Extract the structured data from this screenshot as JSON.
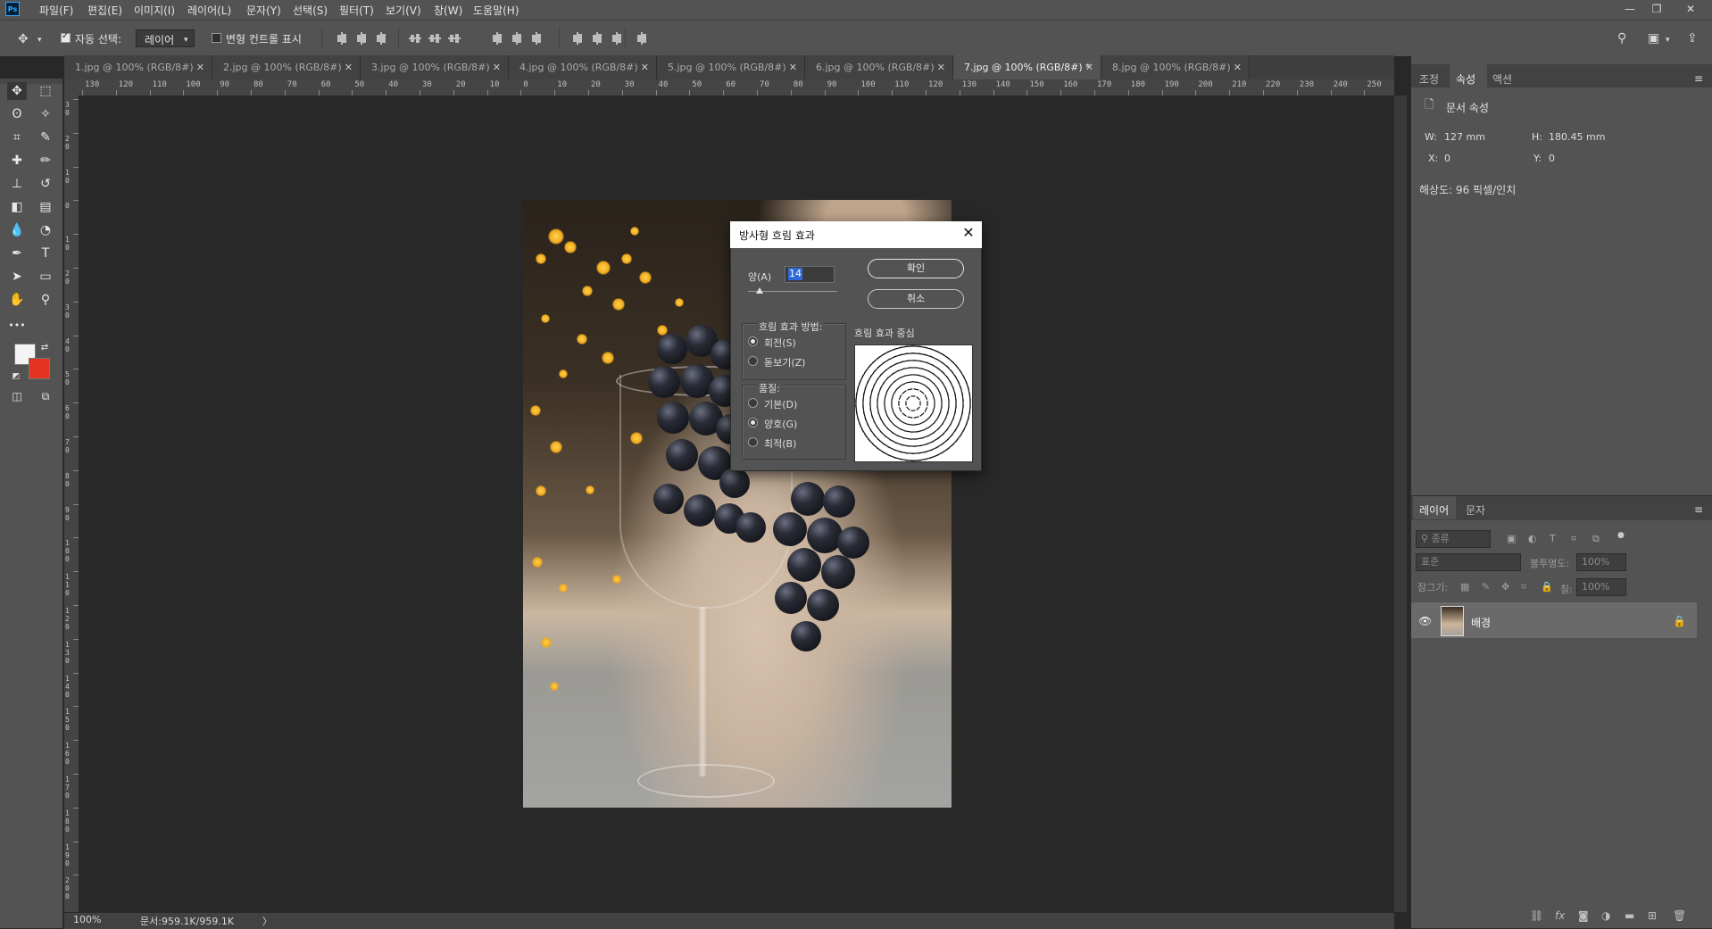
{
  "app": {
    "logo": "Ps"
  },
  "menu": [
    "파일(F)",
    "편집(E)",
    "이미지(I)",
    "레이어(L)",
    "문자(Y)",
    "선택(S)",
    "필터(T)",
    "보기(V)",
    "창(W)",
    "도움말(H)"
  ],
  "window_controls": [
    "minimize-icon",
    "restore-icon",
    "close-icon"
  ],
  "options_bar": {
    "auto_select_label": "자동 선택:",
    "auto_select_checked": true,
    "auto_select_value": "레이어",
    "transform_label": "변형 컨트롤 표시",
    "transform_checked": false
  },
  "tabs": [
    {
      "label": "1.jpg @ 100% (RGB/8#)",
      "active": false
    },
    {
      "label": "2.jpg @ 100% (RGB/8#)",
      "active": false
    },
    {
      "label": "3.jpg @ 100% (RGB/8#)",
      "active": false
    },
    {
      "label": "4.jpg @ 100% (RGB/8#)",
      "active": false
    },
    {
      "label": "5.jpg @ 100% (RGB/8#)",
      "active": false
    },
    {
      "label": "6.jpg @ 100% (RGB/8#)",
      "active": false
    },
    {
      "label": "7.jpg @ 100% (RGB/8#) *",
      "active": true
    },
    {
      "label": "8.jpg @ 100% (RGB/8#)",
      "active": false
    }
  ],
  "ruler_top_labels": [
    "130",
    "120",
    "110",
    "100",
    "90",
    "80",
    "70",
    "60",
    "50",
    "40",
    "30",
    "20",
    "10",
    "0",
    "10",
    "20",
    "30",
    "40",
    "50",
    "60",
    "70",
    "80",
    "90",
    "100",
    "110",
    "120",
    "130",
    "140",
    "150",
    "160",
    "170",
    "180",
    "190",
    "200",
    "210",
    "220",
    "230",
    "240",
    "250"
  ],
  "ruler_left_labels": [
    "30",
    "20",
    "10",
    "0",
    "10",
    "20",
    "30",
    "40",
    "50",
    "60",
    "70",
    "80",
    "90",
    "100",
    "110",
    "120",
    "130",
    "140",
    "150",
    "160",
    "170",
    "180",
    "190",
    "200"
  ],
  "toolbox": {
    "tools": [
      {
        "name": "move-tool-icon",
        "glyph": "✥"
      },
      {
        "name": "marquee-tool-icon",
        "glyph": "⬚"
      },
      {
        "name": "lasso-tool-icon",
        "glyph": "ʘ"
      },
      {
        "name": "magic-wand-icon",
        "glyph": "✧"
      },
      {
        "name": "crop-tool-icon",
        "glyph": "⌗"
      },
      {
        "name": "eyedropper-icon",
        "glyph": "✎"
      },
      {
        "name": "healing-brush-icon",
        "glyph": "✚"
      },
      {
        "name": "brush-tool-icon",
        "glyph": "✏"
      },
      {
        "name": "stamp-tool-icon",
        "glyph": "⊥"
      },
      {
        "name": "history-brush-icon",
        "glyph": "↺"
      },
      {
        "name": "eraser-tool-icon",
        "glyph": "◧"
      },
      {
        "name": "gradient-tool-icon",
        "glyph": "▤"
      },
      {
        "name": "blur-tool-icon",
        "glyph": "💧"
      },
      {
        "name": "dodge-tool-icon",
        "glyph": "◔"
      },
      {
        "name": "pen-tool-icon",
        "glyph": "✒"
      },
      {
        "name": "type-tool-icon",
        "glyph": "T"
      },
      {
        "name": "path-select-icon",
        "glyph": "➤"
      },
      {
        "name": "rectangle-tool-icon",
        "glyph": "▭"
      },
      {
        "name": "hand-tool-icon",
        "glyph": "✋"
      },
      {
        "name": "zoom-tool-icon",
        "glyph": "⚲"
      }
    ],
    "more": "•••",
    "fg_color": "#f4f4f4",
    "bg_color": "#e4331f"
  },
  "status": {
    "zoom": "100%",
    "doc": "문서:959.1K/959.1K",
    "arrow": "〉"
  },
  "properties_panel": {
    "tabs": [
      "조정",
      "속성",
      "액션"
    ],
    "active_tab": "속성",
    "title": "문서 속성",
    "w_label": "W:",
    "w_value": "127 mm",
    "h_label": "H:",
    "h_value": "180.45 mm",
    "x_label": "X:",
    "x_value": "0",
    "y_label": "Y:",
    "y_value": "0",
    "resolution": "해상도: 96 픽셀/인치"
  },
  "layers_panel": {
    "tabs": [
      "레이어",
      "문자"
    ],
    "active_tab": "레이어",
    "filter_placeholder": "종류",
    "blend_mode": "표준",
    "opacity_label": "불투명도:",
    "opacity_value": "100%",
    "lock_label": "잠그기:",
    "fill_label": "칠:",
    "fill_value": "100%",
    "layers": [
      {
        "name": "배경",
        "visible": true,
        "locked": true
      }
    ]
  },
  "dialog": {
    "title": "방사형 흐림 효과",
    "amount_label": "양(A)",
    "amount_value": "14",
    "ok_label": "확인",
    "cancel_label": "취소",
    "method_label": "흐림 효과 방법:",
    "method_options": [
      {
        "label": "회전(S)",
        "checked": true
      },
      {
        "label": "돋보기(Z)",
        "checked": false
      }
    ],
    "quality_label": "품질:",
    "quality_options": [
      {
        "label": "기본(D)",
        "checked": false
      },
      {
        "label": "양호(G)",
        "checked": true
      },
      {
        "label": "최적(B)",
        "checked": false
      }
    ],
    "center_label": "흐림 효과 중심"
  }
}
